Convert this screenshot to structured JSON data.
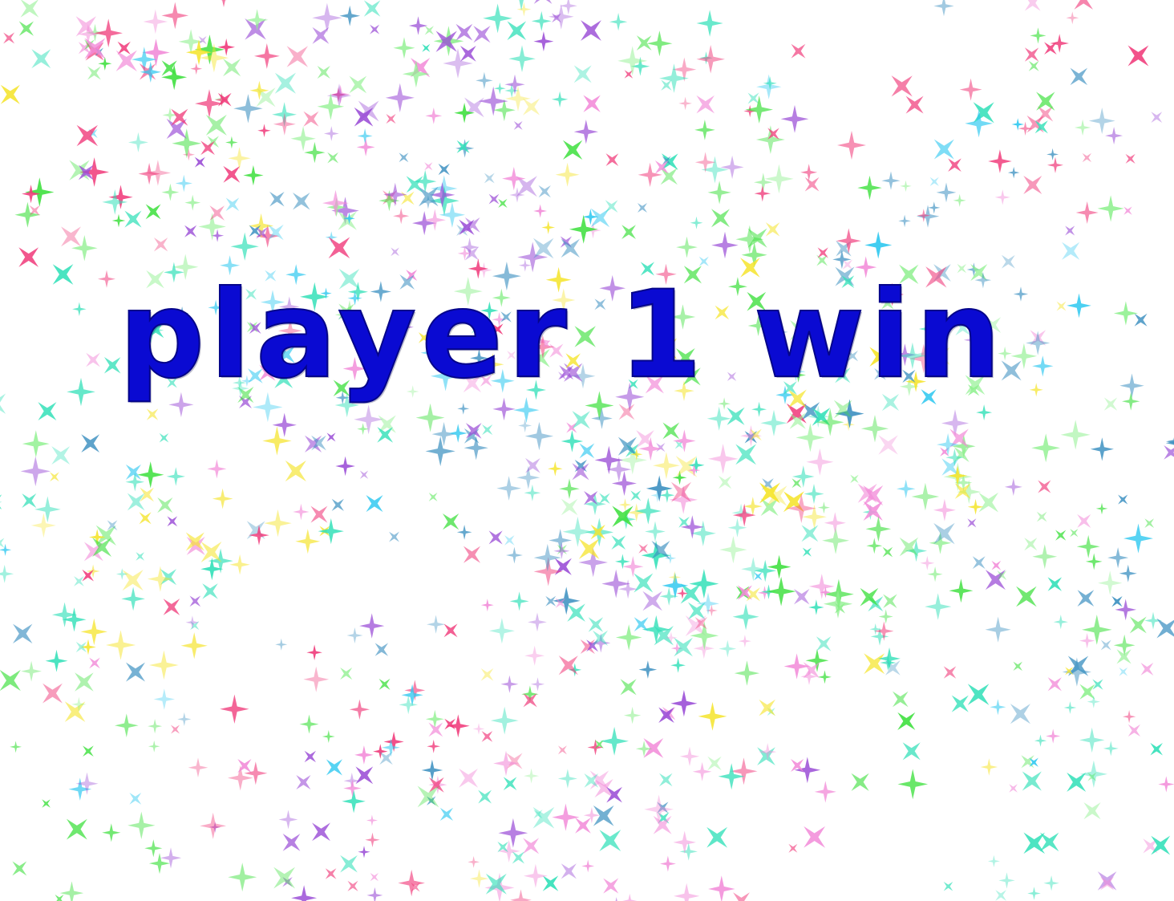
{
  "game": {
    "result_message": "player 1 win",
    "result_text_color": "#0a0ad2"
  },
  "background": {
    "style": "scattered four-point sparkles on white",
    "base_color": "#ffffff",
    "sparkle_colors": [
      "#f5e42a",
      "#3fe03f",
      "#2ec8f0",
      "#9a4cd6",
      "#f03a7a",
      "#31e0b8",
      "#3a8fc0",
      "#8ff08f",
      "#f28ad8"
    ]
  }
}
